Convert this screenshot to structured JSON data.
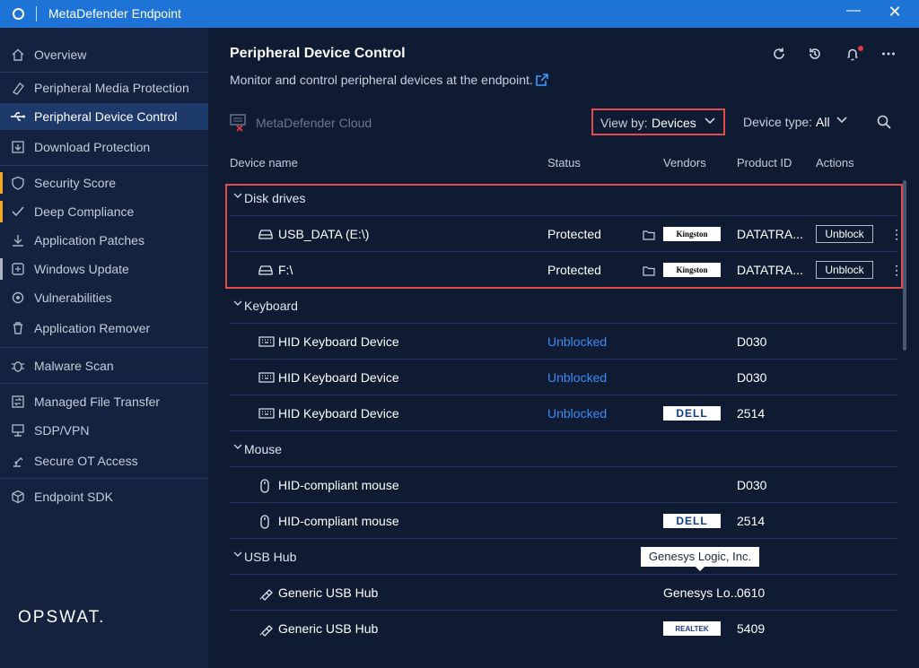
{
  "window": {
    "title": "MetaDefender Endpoint"
  },
  "sidebar": {
    "items": [
      {
        "label": "Overview",
        "icon": "home-icon"
      },
      {
        "label": "Peripheral Media Protection",
        "icon": "eraser-icon"
      },
      {
        "label": "Peripheral Device Control",
        "icon": "usb-icon"
      },
      {
        "label": "Download Protection",
        "icon": "download-protection-icon"
      },
      {
        "label": "Security Score",
        "icon": "shield-icon"
      },
      {
        "label": "Deep Compliance",
        "icon": "compliance-check-icon"
      },
      {
        "label": "Application Patches",
        "icon": "download-icon"
      },
      {
        "label": "Windows Update",
        "icon": "windows-update-icon"
      },
      {
        "label": "Vulnerabilities",
        "icon": "vulnerability-icon"
      },
      {
        "label": "Application Remover",
        "icon": "trash-icon"
      },
      {
        "label": "Malware Scan",
        "icon": "bug-icon"
      },
      {
        "label": "Managed File Transfer",
        "icon": "file-transfer-icon"
      },
      {
        "label": "SDP/VPN",
        "icon": "monitor-network-icon"
      },
      {
        "label": "Secure OT Access",
        "icon": "robot-arm-icon"
      },
      {
        "label": "Endpoint SDK",
        "icon": "cube-icon"
      }
    ],
    "logo": "OPSWAT."
  },
  "header": {
    "title": "Peripheral Device Control",
    "subtitle": "Monitor and control peripheral devices at the endpoint."
  },
  "toolbar": {
    "cloud_label": "MetaDefender Cloud",
    "view_by_label": "View by:",
    "view_by_value": "Devices",
    "device_type_label": "Device type:",
    "device_type_value": "All"
  },
  "table": {
    "columns": [
      "Device name",
      "Status",
      "Vendors",
      "Product ID",
      "Actions"
    ],
    "groups": [
      {
        "name": "Disk drives",
        "rows": [
          {
            "name": "USB_DATA (E:\\)",
            "status": "Protected",
            "vendor": "Kingston",
            "pid": "DATATRA...",
            "action": "Unblock"
          },
          {
            "name": "F:\\",
            "status": "Protected",
            "vendor": "Kingston",
            "pid": "DATATRA...",
            "action": "Unblock"
          }
        ]
      },
      {
        "name": "Keyboard",
        "rows": [
          {
            "name": "HID Keyboard Device",
            "status": "Unblocked",
            "vendor": "",
            "pid": "D030"
          },
          {
            "name": "HID Keyboard Device",
            "status": "Unblocked",
            "vendor": "",
            "pid": "D030"
          },
          {
            "name": "HID Keyboard Device",
            "status": "Unblocked",
            "vendor": "DELL",
            "pid": "2514"
          }
        ]
      },
      {
        "name": "Mouse",
        "rows": [
          {
            "name": "HID-compliant mouse",
            "status": "",
            "vendor": "",
            "pid": "D030"
          },
          {
            "name": "HID-compliant mouse",
            "status": "",
            "vendor": "DELL",
            "pid": "2514"
          }
        ]
      },
      {
        "name": "USB Hub",
        "rows": [
          {
            "name": "Generic USB Hub",
            "status": "",
            "vendor": "Genesys Lo...",
            "pid": "0610"
          },
          {
            "name": "Generic USB Hub",
            "status": "",
            "vendor": "REALTEK",
            "pid": "5409"
          }
        ]
      }
    ]
  },
  "tooltip": {
    "text": "Genesys Logic, Inc."
  },
  "colors": {
    "titlebar": "#1e73d6",
    "sidebar": "#14223f",
    "main": "#0f1b33",
    "active_nav": "#1d3a6b",
    "highlight": "#e24c4c",
    "link": "#3b8cf7",
    "warning_flag": "#f2a91e"
  }
}
